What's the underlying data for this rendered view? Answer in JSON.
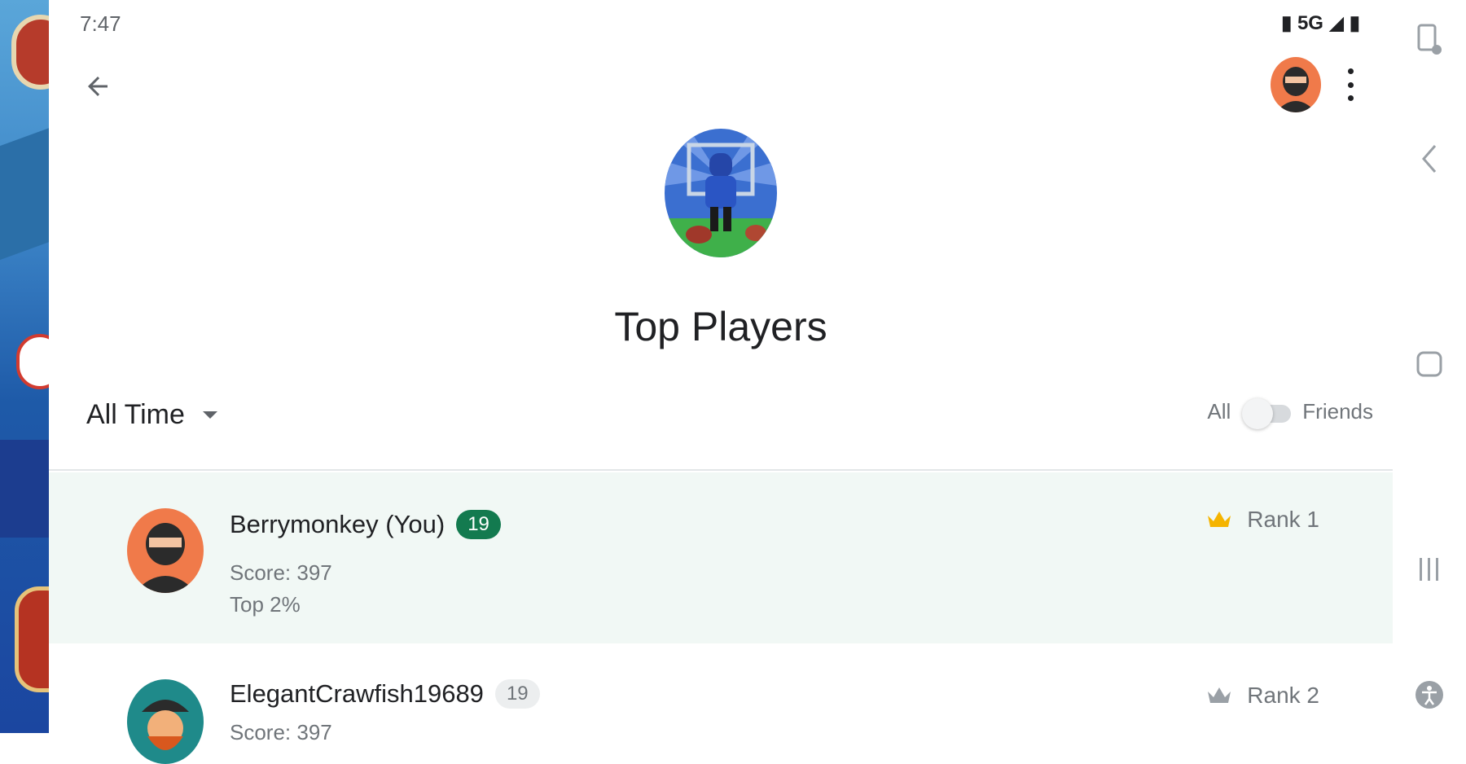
{
  "status": {
    "time": "7:47",
    "network": "5G"
  },
  "header": {
    "title": "Top Players"
  },
  "filters": {
    "time_range": "All Time",
    "scope_left": "All",
    "scope_right": "Friends",
    "friends_only": false
  },
  "leaderboard": [
    {
      "name": "Berrymonkey (You)",
      "level": "19",
      "score": "Score: 397",
      "percentile": "Top 2%",
      "rank": "Rank 1",
      "rank_icon": "crown-icon",
      "rank_icon_color": "#f5b400",
      "highlight": true
    },
    {
      "name": "ElegantCrawfish19689",
      "level": "19",
      "score": "Score: 397",
      "rank": "Rank 2",
      "rank_icon": "crown-icon",
      "rank_icon_color": "#9aa0a6",
      "highlight": false
    }
  ],
  "colors": {
    "accent_green": "#137a4f",
    "highlight_row": "#f1f8f5",
    "text_primary": "#202124",
    "text_secondary": "#70757a"
  },
  "navbar_icons": [
    "screenshot-icon",
    "chevron-left-icon",
    "home-square-icon",
    "recents-icon",
    "accessibility-icon"
  ]
}
